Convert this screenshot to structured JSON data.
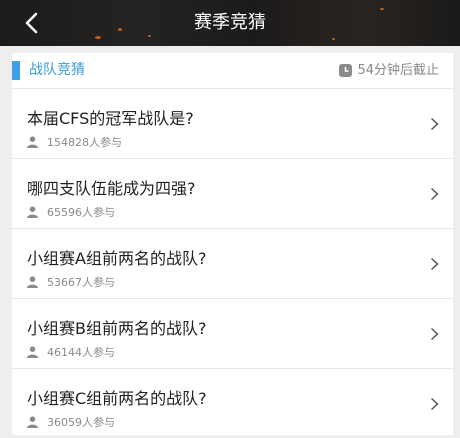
{
  "header": {
    "title": "赛季竞猜",
    "back_icon": "chevron-left-icon"
  },
  "section": {
    "title": "战队竞猜",
    "deadline": "54分钟后截止",
    "accent_color": "#3ea0e6"
  },
  "questions": [
    {
      "title": "本届CFS的冠军战队是?",
      "participants": "154828人参与"
    },
    {
      "title": "哪四支队伍能成为四强?",
      "participants": "65596人参与"
    },
    {
      "title": "小组赛A组前两名的战队?",
      "participants": "53667人参与"
    },
    {
      "title": "小组赛B组前两名的战队?",
      "participants": "46144人参与"
    },
    {
      "title": "小组赛C组前两名的战队?",
      "participants": "36059人参与"
    }
  ]
}
